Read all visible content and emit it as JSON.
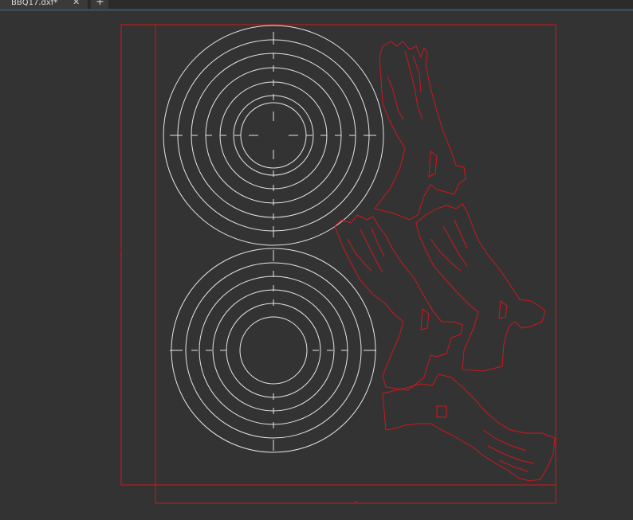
{
  "tab": {
    "title": "BBQ17.dxf*",
    "close_glyph": "✕",
    "add_glyph": "+"
  },
  "colors": {
    "background": "#333333",
    "outline_red": "#d0171b",
    "circle_white": "#e6e6e6"
  },
  "icons": [
    "close-icon",
    "add-tab-icon"
  ]
}
